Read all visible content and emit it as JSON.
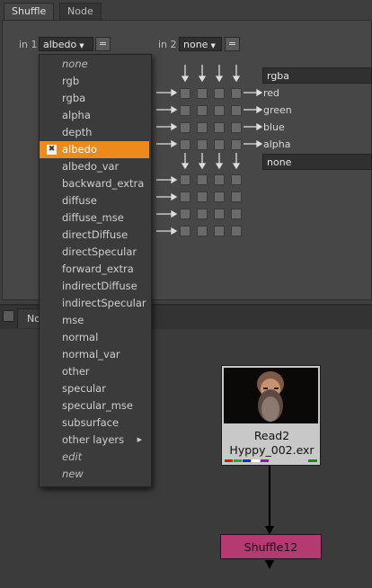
{
  "tabs": [
    "Shuffle",
    "Node"
  ],
  "in1": {
    "label": "in 1",
    "value": "albedo"
  },
  "in2": {
    "label": "in 2",
    "value": "none"
  },
  "eq_label": "=",
  "out1": {
    "value": "rgba",
    "channels": [
      "red",
      "green",
      "blue",
      "alpha"
    ]
  },
  "out2": {
    "value": "none"
  },
  "graph_tab_label": "No",
  "dropdown": {
    "items": [
      {
        "label": "none",
        "style": "italic"
      },
      {
        "label": "rgb"
      },
      {
        "label": "rgba"
      },
      {
        "label": "alpha"
      },
      {
        "label": "depth"
      },
      {
        "label": "albedo",
        "selected": true
      },
      {
        "label": "albedo_var"
      },
      {
        "label": "backward_extra"
      },
      {
        "label": "diffuse"
      },
      {
        "label": "diffuse_mse"
      },
      {
        "label": "directDiffuse"
      },
      {
        "label": "directSpecular"
      },
      {
        "label": "forward_extra"
      },
      {
        "label": "indirectDiffuse"
      },
      {
        "label": "indirectSpecular"
      },
      {
        "label": "mse"
      },
      {
        "label": "normal"
      },
      {
        "label": "normal_var"
      },
      {
        "label": "other"
      },
      {
        "label": "specular"
      },
      {
        "label": "specular_mse"
      },
      {
        "label": "subsurface"
      },
      {
        "label": "other layers",
        "submenu": true
      },
      {
        "label": "edit",
        "style": "italic"
      },
      {
        "label": "new",
        "style": "italic"
      }
    ]
  },
  "read_node": {
    "title": "Read2",
    "file": "Hyppy_002.exr"
  },
  "shuffle_node": {
    "title": "Shuffle12"
  },
  "colors": {
    "selection": "#ee8a1b",
    "shuffle_node": "#b53a72",
    "read_node": "#c8c8c8"
  }
}
